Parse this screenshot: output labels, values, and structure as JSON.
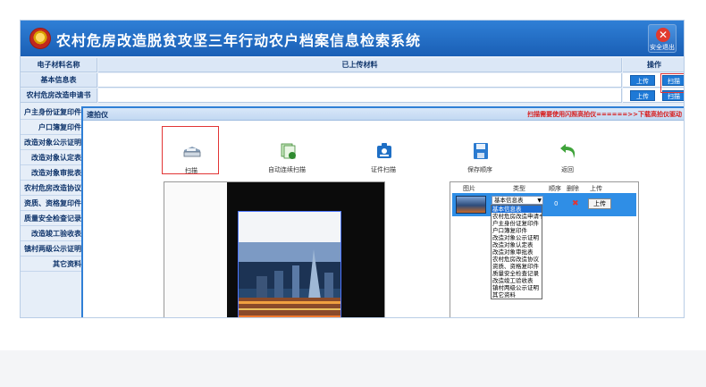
{
  "header": {
    "title": "农村危房改造脱贫攻坚三年行动农户档案信息检索系统",
    "exit_label": "安全退出",
    "exit_glyph": "✕"
  },
  "table": {
    "columns": [
      "电子材料名称",
      "已上传材料",
      "操作"
    ],
    "rows": [
      {
        "name": "基本信息表",
        "upload": "上传",
        "scan": "扫描"
      },
      {
        "name": "农村危房改造申请书",
        "upload": "上传",
        "scan": "扫描"
      }
    ]
  },
  "left_list": [
    "户主身份证复印件",
    "户口簿复印件",
    "改造对象公示证明",
    "改造对象认定表",
    "改造对象审批表",
    "农村危房改造协议",
    "资质、资格复印件",
    "质量安全检查记录",
    "改造竣工验收表",
    "镇村两级公示证明",
    "其它资料"
  ],
  "dialog": {
    "title": "速拍仪",
    "note": "扫描需要使用闪照高拍仪======>>下载高拍仪驱动",
    "tools": [
      {
        "label": "扫描",
        "icon": "scanner-icon"
      },
      {
        "label": "自动连续扫描",
        "icon": "auto-scan-icon"
      },
      {
        "label": "证件扫描",
        "icon": "id-card-icon"
      },
      {
        "label": "保存顺序",
        "icon": "save-icon"
      },
      {
        "label": "返回",
        "icon": "back-arrow-icon"
      }
    ],
    "panel": {
      "headers": [
        "图片",
        "类型",
        "顺序",
        "删除",
        "上传"
      ],
      "selected_type": "基本信息表",
      "order": "0",
      "delete_glyph": "✖",
      "upload_label": "上传",
      "type_options": [
        "基本信息表",
        "农村危房改造申请书",
        "户主身份证复印件",
        "户口簿复印件",
        "改造对象公示证明",
        "改造对象认定表",
        "改造对象审批表",
        "农村危房改造协议",
        "资质、资格复印件",
        "质量安全检查记录",
        "改造竣工验收表",
        "镇村两级公示证明",
        "其它资料"
      ]
    }
  },
  "colors": {
    "accent": "#1e79d6",
    "header_blue": "#1a5fb5",
    "highlight_red": "#e23535"
  }
}
